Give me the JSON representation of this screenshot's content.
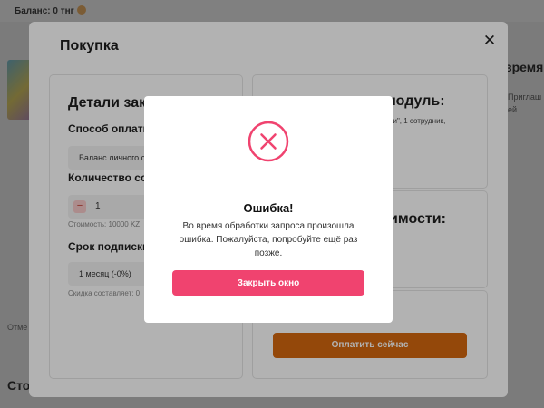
{
  "background": {
    "balance": "Баланс: 0 тнг",
    "right_title": "время п",
    "right_sub_1": "Приглаш",
    "right_sub_2": "ей",
    "left_text": "Отме",
    "bottom_title": "Сто"
  },
  "purchase_modal": {
    "title": "Покупка",
    "close": "✕",
    "details": {
      "heading": "Детали зака",
      "payment_label": "Способ оплаты:",
      "payment_value": "Баланс личного с",
      "count_label": "Количество сотр",
      "count_minus": "−",
      "count_value": "1",
      "cost_note": "Стоимость: 10000 KZ",
      "period_label": "Срок подписки",
      "period_value": "1 месяц (-0%)",
      "discount_note": "Скидка составляет: 0"
    },
    "module": {
      "heading": "модуль:",
      "subtext": "ии\", 1 сотрудник,"
    },
    "cost": {
      "heading": "имости:"
    },
    "pay_button": "Оплатить сейчас"
  },
  "error_dialog": {
    "title": "Ошибка!",
    "message": "Во время обработки запроса произошла ошибка. Пожалуйста, попробуйте ещё раз позже.",
    "close_button": "Закрыть окно",
    "accent_color": "#f0436f"
  }
}
